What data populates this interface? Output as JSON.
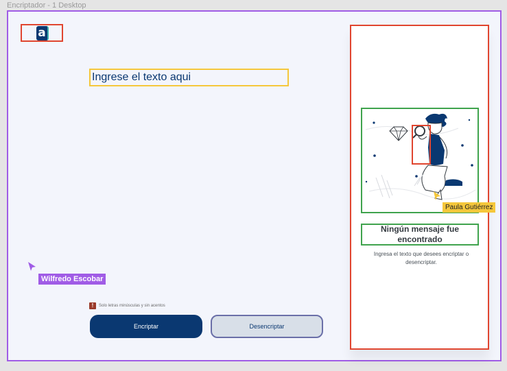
{
  "frame": {
    "title": "Encriptador - 1 Desktop"
  },
  "logo": {
    "letter": "a"
  },
  "input": {
    "placeholder": "Ingrese el texto aqui"
  },
  "hint": {
    "icon": "!",
    "text": "Solo letras minúsculas y sin acentos"
  },
  "buttons": {
    "encrypt": "Encriptar",
    "decrypt": "Desencriptar"
  },
  "collaborators": [
    {
      "name": "Wilfredo Escobar",
      "color": "#a05ce6"
    },
    {
      "name": "Paula Gutiérrez",
      "color": "#f5c73b"
    }
  ],
  "panel": {
    "title": "Ningún mensaje fue encontrado",
    "subtitle": "Ingresa el texto que desees encriptar o desencriptar."
  },
  "colors": {
    "primary": "#0a3871",
    "frame_selection": "#a05ce6",
    "annotation_red": "#e0452f",
    "annotation_green": "#3fa34d",
    "annotation_yellow": "#f5c73b"
  },
  "icons": [
    "cursor-arrow-icon",
    "alert-icon",
    "diamond-icon",
    "magnifier-icon"
  ]
}
